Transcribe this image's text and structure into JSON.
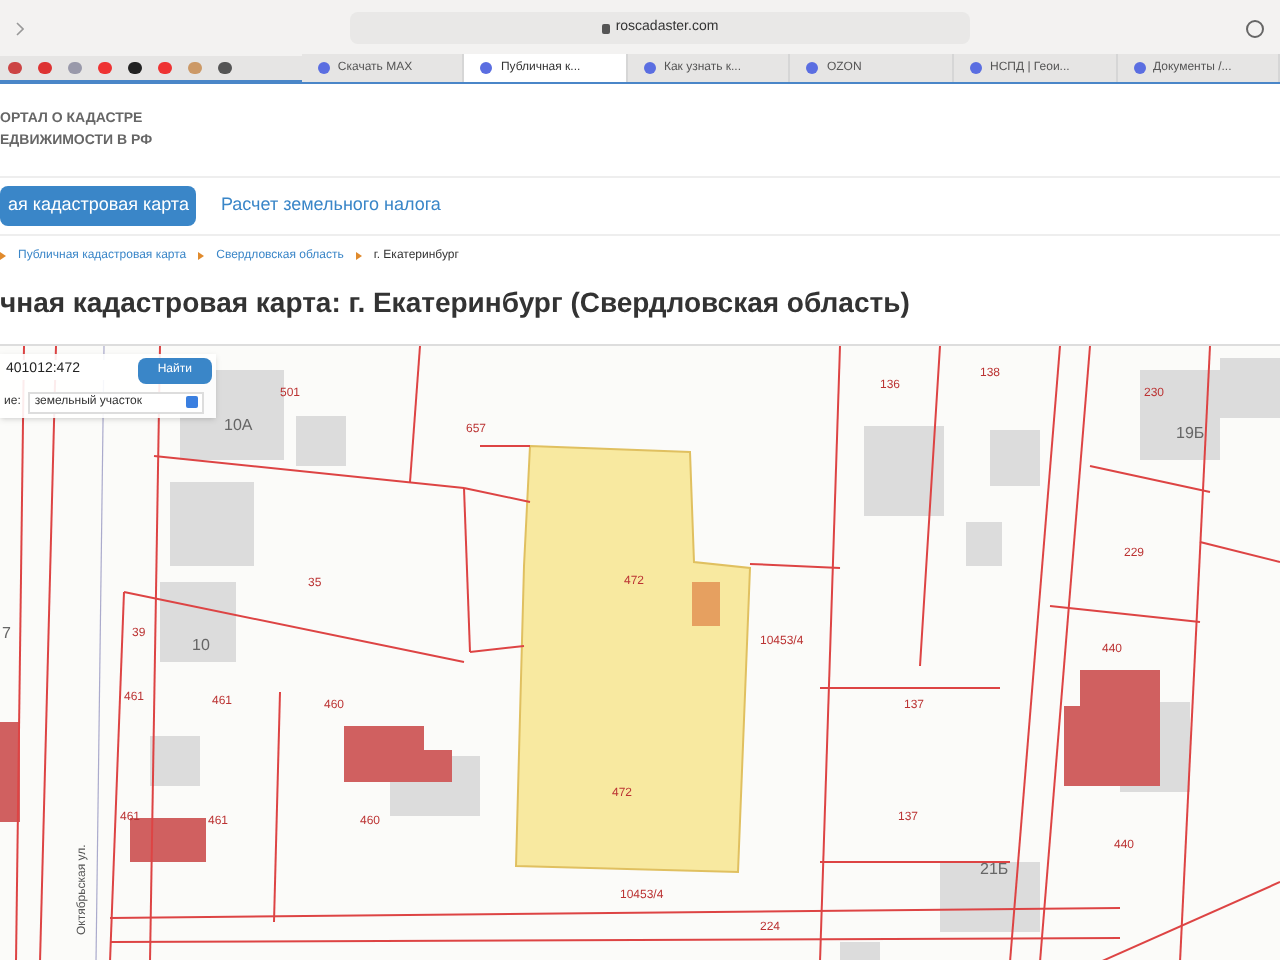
{
  "browser": {
    "url": "roscadaster.com",
    "tabs": [
      {
        "label": "Скачать MAX",
        "selected": false
      },
      {
        "label": "Публичная к...",
        "selected": true
      },
      {
        "label": "Как узнать к...",
        "selected": false
      },
      {
        "label": "OZON",
        "selected": false
      },
      {
        "label": "НСПД | Геои...",
        "selected": false
      },
      {
        "label": "Документы /...",
        "selected": false
      }
    ]
  },
  "header": {
    "logo_lines": [
      "ОРТАЛ О КАДАСТРЕ",
      "ЕДВИЖИМОСТИ В РФ"
    ],
    "nav": [
      {
        "label": "ая кадастровая карта",
        "selected": true
      },
      {
        "label": "Расчет земельного налога",
        "selected": false
      }
    ]
  },
  "breadcrumbs": [
    "Публичная кадастровая карта",
    "Свердловская область",
    "г. Екатеринбург"
  ],
  "title": "чная кадастровая карта: г. Екатеринбург (Свердловская область)",
  "map": {
    "search": {
      "value": "401012:472",
      "button": "Найти",
      "type_label": "ие:",
      "type_value": "земельный участок"
    },
    "labels": [
      {
        "text": "501",
        "kind": "parcel"
      },
      {
        "text": "10А",
        "kind": "house"
      },
      {
        "text": "657",
        "kind": "parcel"
      },
      {
        "text": "136",
        "kind": "parcel"
      },
      {
        "text": "138",
        "kind": "parcel"
      },
      {
        "text": "230",
        "kind": "parcel"
      },
      {
        "text": "19Б",
        "kind": "house"
      },
      {
        "text": "35",
        "kind": "parcel"
      },
      {
        "text": "472",
        "kind": "parcel"
      },
      {
        "text": "10",
        "kind": "house"
      },
      {
        "text": "39",
        "kind": "parcel"
      },
      {
        "text": "10453/4",
        "kind": "parcel"
      },
      {
        "text": "229",
        "kind": "parcel"
      },
      {
        "text": "7",
        "kind": "house"
      },
      {
        "text": "461",
        "kind": "parcel"
      },
      {
        "text": "461",
        "kind": "parcel"
      },
      {
        "text": "460",
        "kind": "parcel"
      },
      {
        "text": "461",
        "kind": "parcel"
      },
      {
        "text": "461",
        "kind": "parcel"
      },
      {
        "text": "460",
        "kind": "parcel"
      },
      {
        "text": "472",
        "kind": "parcel"
      },
      {
        "text": "137",
        "kind": "parcel"
      },
      {
        "text": "137",
        "kind": "parcel"
      },
      {
        "text": "21Б",
        "kind": "house"
      },
      {
        "text": "440",
        "kind": "parcel"
      },
      {
        "text": "440",
        "kind": "parcel"
      },
      {
        "text": "224",
        "kind": "parcel"
      },
      {
        "text": "10453/4",
        "kind": "parcel"
      }
    ],
    "street": "Октябрьская ул."
  }
}
